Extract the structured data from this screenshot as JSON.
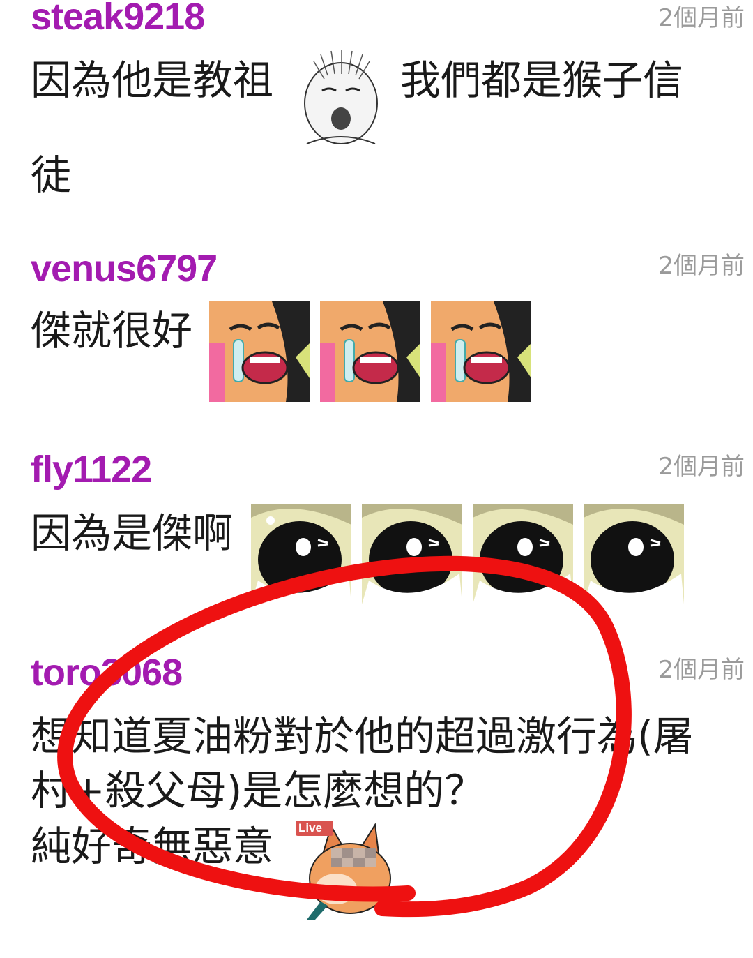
{
  "comments": [
    {
      "username": "steak9218",
      "time": "2個月前",
      "text_part1": "因為他是教祖",
      "text_part2": "我們都是猴子信",
      "text_part3": "徒",
      "sticker_icon": "shocked-face-sketch-icon"
    },
    {
      "username": "venus6797",
      "time": "2個月前",
      "text": "傑就很好",
      "sticker_icon": "crying-fox-icon"
    },
    {
      "username": "fly1122",
      "time": "2個月前",
      "text": "因為是傑啊",
      "sticker_icon": "shouting-penguin-icon"
    },
    {
      "username": "toro3068",
      "time": "2個月前",
      "text_line1": "想知道夏油粉對於他的超過激行為(屠",
      "text_line2": "村+殺父母)是怎麼想的？",
      "text_line3": "純好奇無惡意",
      "sticker_badge": "Live",
      "sticker_icon": "live-fox-icon"
    }
  ],
  "colors": {
    "username": "#a31bb0",
    "timestamp": "#9a9a9a",
    "annotation_circle": "#ee1111"
  }
}
